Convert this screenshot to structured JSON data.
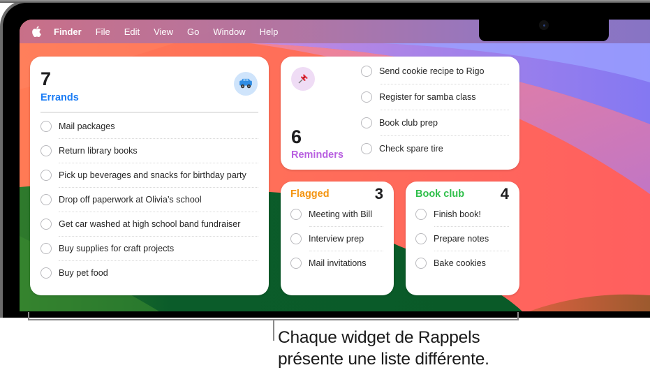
{
  "menubar": {
    "apple_icon": "apple-logo-icon",
    "items": [
      "Finder",
      "File",
      "Edit",
      "View",
      "Go",
      "Window",
      "Help"
    ]
  },
  "widgets": {
    "errands": {
      "count": "7",
      "title": "Errands",
      "title_color": "#1a7cf5",
      "icon": "car-icon",
      "icon_bg": "#cfe4fb",
      "tasks": [
        "Mail packages",
        "Return library books",
        "Pick up beverages and snacks for birthday party",
        "Drop off paperwork at Olivia’s school",
        "Get car washed at high school band fundraiser",
        "Buy supplies for craft projects",
        "Buy pet food"
      ]
    },
    "reminders": {
      "count": "6",
      "title": "Reminders",
      "title_color": "#b85fe0",
      "icon": "pushpin-icon",
      "icon_bg": "#efdcf5",
      "tasks": [
        "Send cookie recipe to Rigo",
        "Register for samba class",
        "Book club prep",
        "Check spare tire"
      ]
    },
    "flagged": {
      "count": "3",
      "title": "Flagged",
      "title_color": "#f4940f",
      "tasks": [
        "Meeting with Bill",
        "Interview prep",
        "Mail invitations"
      ]
    },
    "bookclub": {
      "count": "4",
      "title": "Book club",
      "title_color": "#2fbf4a",
      "tasks": [
        "Finish book!",
        "Prepare notes",
        "Bake cookies"
      ]
    }
  },
  "caption": {
    "line1": "Chaque widget de Rappels",
    "line2": "présente une liste différente."
  }
}
